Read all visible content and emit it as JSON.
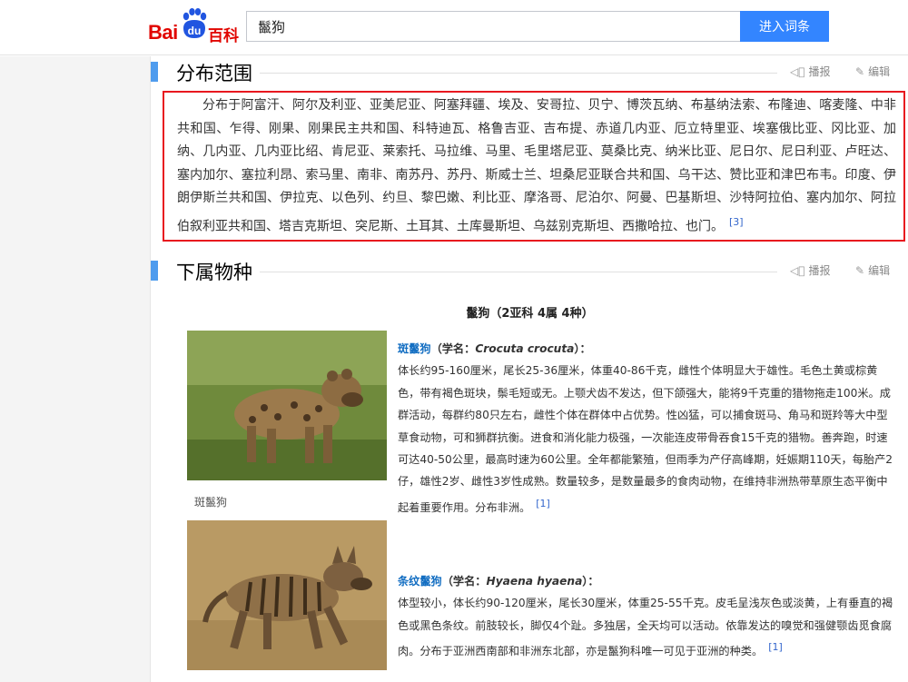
{
  "header": {
    "logo_text_bai": "Bai",
    "logo_text_du": "du",
    "logo_text_baike": "百科",
    "search_value": "鬣狗",
    "search_button": "进入词条"
  },
  "sections": [
    {
      "title": "分布范围",
      "tools": {
        "broadcast": "播报",
        "edit": "编辑"
      },
      "paragraph": "分布于阿富汗、阿尔及利亚、亚美尼亚、阿塞拜疆、埃及、安哥拉、贝宁、博茨瓦纳、布基纳法索、布隆迪、喀麦隆、中非共和国、乍得、刚果、刚果民主共和国、科特迪瓦、格鲁吉亚、吉布提、赤道几内亚、厄立特里亚、埃塞俄比亚、冈比亚、加纳、几内亚、几内亚比绍、肯尼亚、莱索托、马拉维、马里、毛里塔尼亚、莫桑比克、纳米比亚、尼日尔、尼日利亚、卢旺达、塞内加尔、塞拉利昂、索马里、南非、南苏丹、苏丹、斯威士兰、坦桑尼亚联合共和国、乌干达、赞比亚和津巴布韦。印度、伊朗伊斯兰共和国、伊拉克、以色列、约旦、黎巴嫩、利比亚、摩洛哥、尼泊尔、阿曼、巴基斯坦、沙特阿拉伯、塞内加尔、阿拉伯叙利亚共和国、塔吉克斯坦、突尼斯、土耳其、土库曼斯坦、乌兹别克斯坦、西撒哈拉、也门。",
      "ref": "[3]"
    },
    {
      "title": "下属物种",
      "tools": {
        "broadcast": "播报",
        "edit": "编辑"
      }
    }
  ],
  "species_table": {
    "caption": "鬣狗（2亚科 4属 4种）",
    "items": [
      {
        "photo_caption": "斑鬣狗",
        "name": "斑鬣狗",
        "latin_prefix": "（学名：",
        "latin": "Crocuta crocuta",
        "latin_suffix": "）：",
        "description": "体长约95-160厘米，尾长25-36厘米，体重40-86千克，雌性个体明显大于雄性。毛色土黄或棕黄色，带有褐色斑块，鬃毛短或无。上颚犬齿不发达，但下颌强大，能将9千克重的猎物拖走100米。成群活动，每群约80只左右，雌性个体在群体中占优势。性凶猛，可以捕食斑马、角马和斑羚等大中型草食动物，可和狮群抗衡。进食和消化能力极强，一次能连皮带骨吞食15千克的猎物。善奔跑，时速可达40-50公里，最高时速为60公里。全年都能繁殖，但雨季为产仔高峰期，妊娠期110天，每胎产2仔，雄性2岁、雌性3岁性成熟。数量较多，是数量最多的食肉动物，在维持非洲热带草原生态平衡中起着重要作用。分布非洲。",
        "ref": "[1]"
      },
      {
        "photo_caption": "条纹鬣狗",
        "name": "条纹鬣狗",
        "latin_prefix": "（学名：",
        "latin": "Hyaena hyaena",
        "latin_suffix": "）：",
        "description": "体型较小，体长约90-120厘米，尾长30厘米，体重25-55千克。皮毛呈浅灰色或淡黄，上有垂直的褐色或黑色条纹。前肢较长，脚仅4个趾。多独居，全天均可以活动。依靠发达的嗅觉和强健颚齿觅食腐肉。分布于亚洲西南部和非洲东北部，亦是鬣狗科唯一可见于亚洲的种类。",
        "ref": "[1]"
      }
    ]
  },
  "colors": {
    "brand_red": "#e10601",
    "brand_blue": "#2155e0",
    "button_blue": "#3385ff",
    "section_bar": "#4f9cee",
    "highlight_border": "#e8181f",
    "link": "#136ec2"
  }
}
